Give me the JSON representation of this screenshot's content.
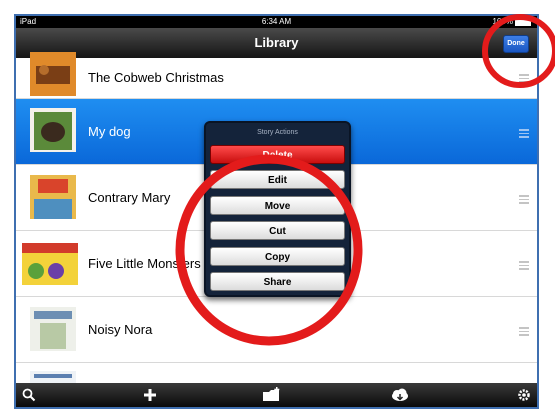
{
  "status_bar": {
    "carrier": "iPad",
    "time": "6:34 AM",
    "battery": "100%"
  },
  "nav": {
    "title": "Library",
    "done_label": "Done"
  },
  "books": [
    {
      "title": "The Cobweb Christmas"
    },
    {
      "title": "My dog",
      "selected": true
    },
    {
      "title": "Contrary Mary"
    },
    {
      "title": "Five Little Monsters"
    },
    {
      "title": "Noisy Nora"
    },
    {
      "title": ""
    }
  ],
  "popup": {
    "title": "Story Actions",
    "actions": [
      "Delete",
      "Edit",
      "Move",
      "Cut",
      "Copy",
      "Share"
    ]
  },
  "toolbar": {
    "icons": [
      "search-icon",
      "add-icon",
      "new-folder-icon",
      "cloud-download-icon",
      "settings-icon"
    ]
  },
  "colors": {
    "highlight_circle": "#e31b1b",
    "selection": "#1a7ee6",
    "delete": "#e02424"
  }
}
